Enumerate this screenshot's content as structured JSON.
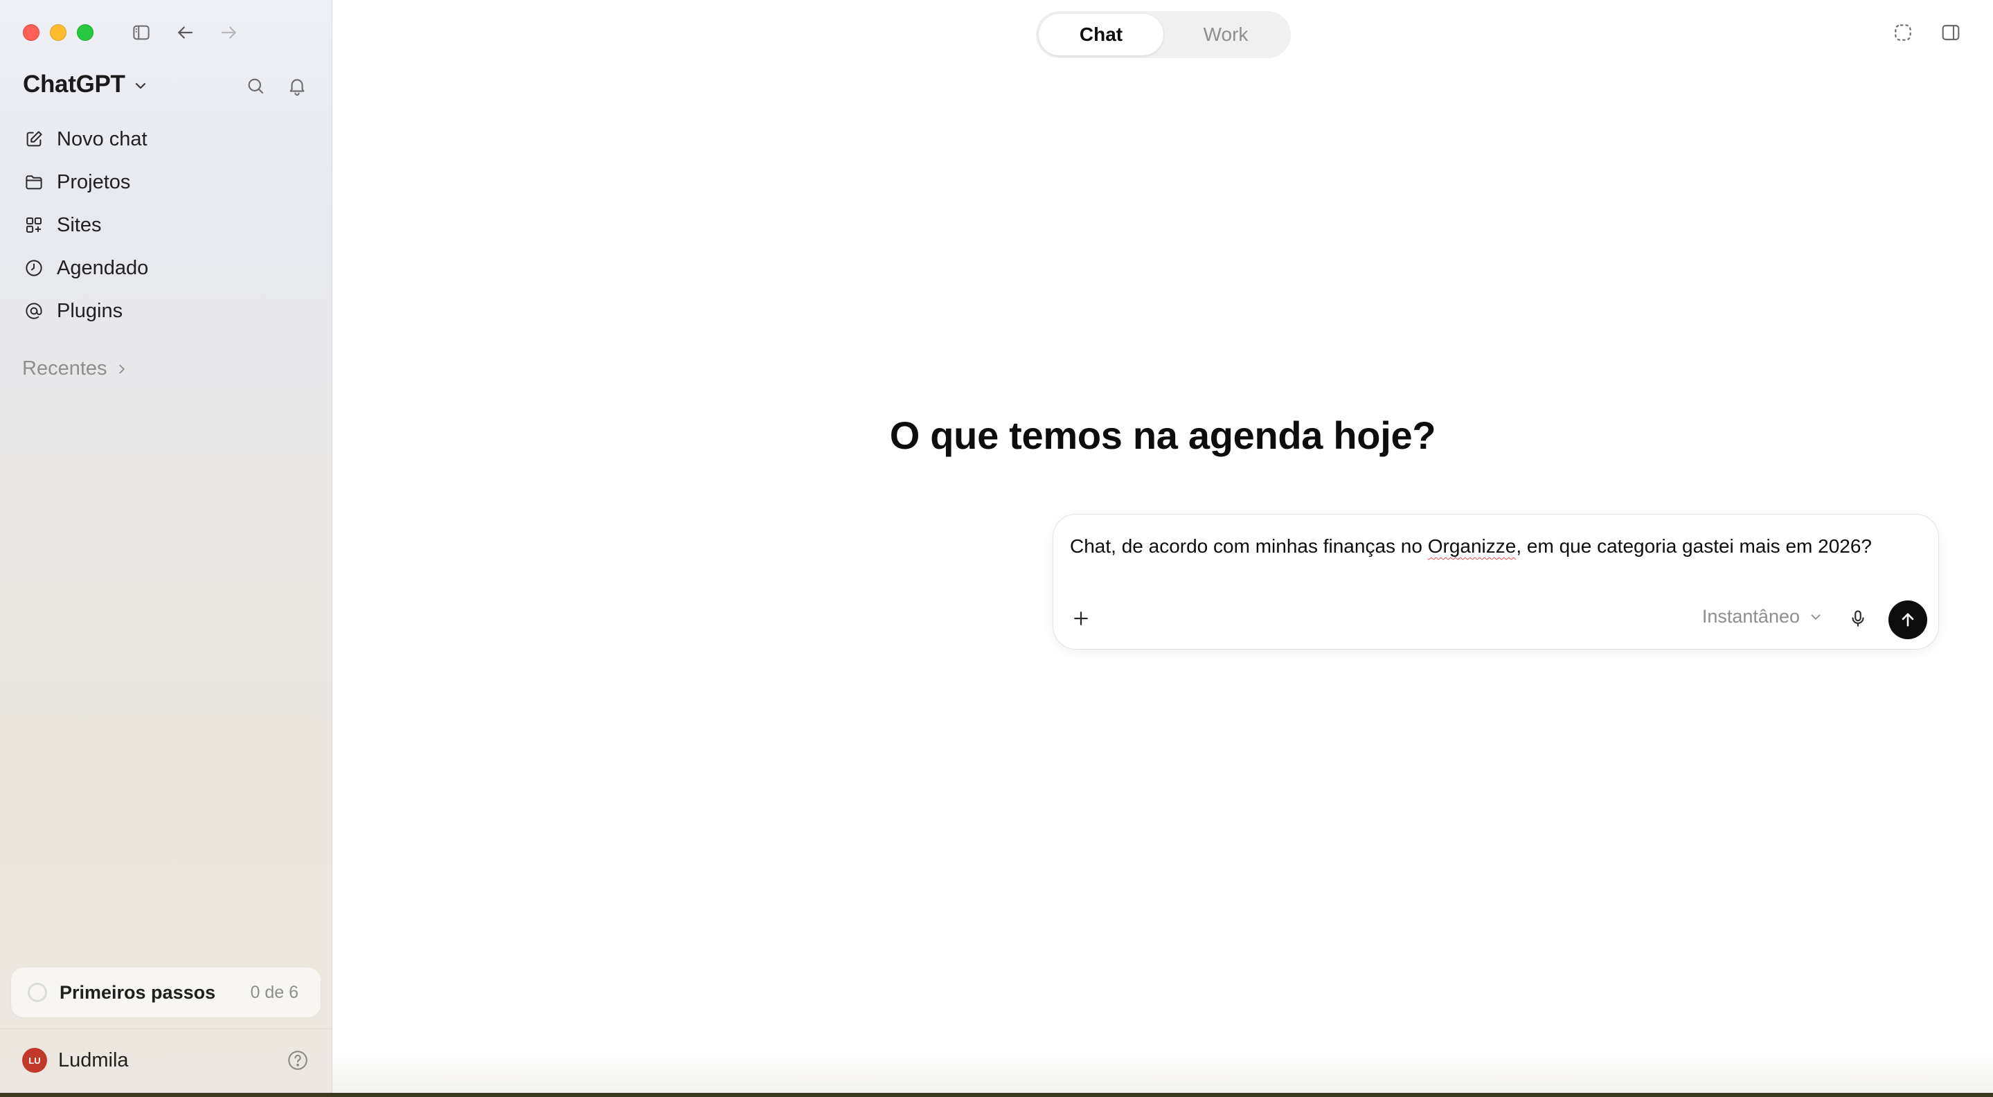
{
  "window": {
    "traffic_lights": [
      "close",
      "minimize",
      "zoom"
    ]
  },
  "toolbar": {
    "icons": [
      "sidebar-toggle-icon",
      "back-arrow-icon",
      "forward-arrow-icon"
    ]
  },
  "sidebar": {
    "brand": "ChatGPT",
    "items": [
      {
        "label": "Novo chat",
        "icon": "compose-icon"
      },
      {
        "label": "Projetos",
        "icon": "folder-icon"
      },
      {
        "label": "Sites",
        "icon": "grid-icon"
      },
      {
        "label": "Agendado",
        "icon": "clock-icon"
      },
      {
        "label": "Plugins",
        "icon": "at-icon"
      }
    ],
    "recent_label": "Recentes",
    "steps": {
      "label": "Primeiros passos",
      "count": "0 de 6"
    },
    "user": {
      "initials": "LU",
      "name": "Ludmila"
    }
  },
  "main": {
    "tabs": [
      {
        "label": "Chat",
        "active": true
      },
      {
        "label": "Work",
        "active": false
      }
    ],
    "headline": "O que temos na agenda hoje?",
    "composer": {
      "text_before": "Chat, de acordo com minhas finanças no ",
      "text_misspelled": "Organizze",
      "text_after": ", em que categoria gastei mais em 2026?",
      "mode_label": "Instantâneo"
    }
  },
  "colors": {
    "send_button": "#0d0d0d",
    "avatar": "#c0392b",
    "muted_text": "#8e8e8e"
  }
}
